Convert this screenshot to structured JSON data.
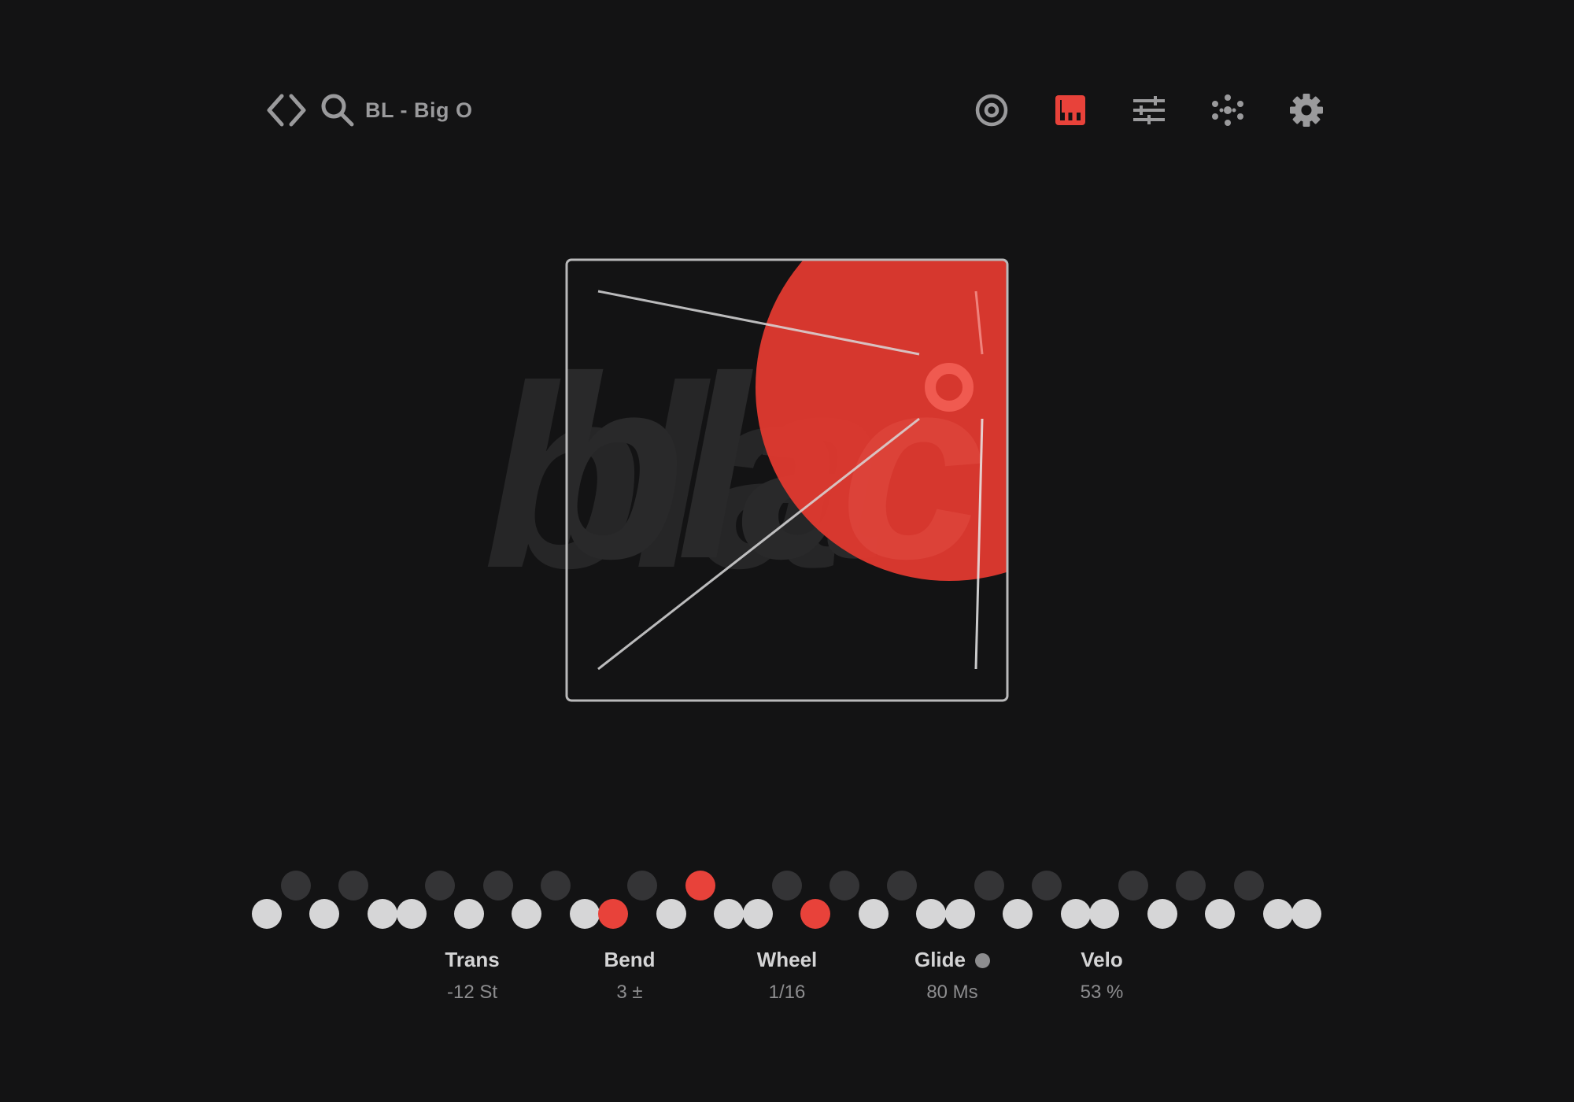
{
  "header": {
    "preset_name": "BL - Big O"
  },
  "icons": {
    "nav": "code-brackets-icon",
    "search": "search-icon",
    "target": "target-icon",
    "keyboard": "piano-keyboard-icon",
    "mixer": "sliders-icon",
    "dots": "dot-grid-icon",
    "settings": "gear-icon"
  },
  "active_view": "keyboard",
  "background_brand_text": "black",
  "keyboard": {
    "active_keys": [
      12,
      15,
      19
    ],
    "accent_color": "#e8423a"
  },
  "params": [
    {
      "label": "Trans",
      "value": "-12 St"
    },
    {
      "label": "Bend",
      "value": "3 ±"
    },
    {
      "label": "Wheel",
      "value": "1/16"
    },
    {
      "label": "Glide",
      "value": "80 Ms"
    },
    {
      "label": "Velo",
      "value": "53 %"
    }
  ],
  "colors": {
    "background": "#131314",
    "accent": "#e8423a",
    "icon": "#9a9a9c"
  }
}
